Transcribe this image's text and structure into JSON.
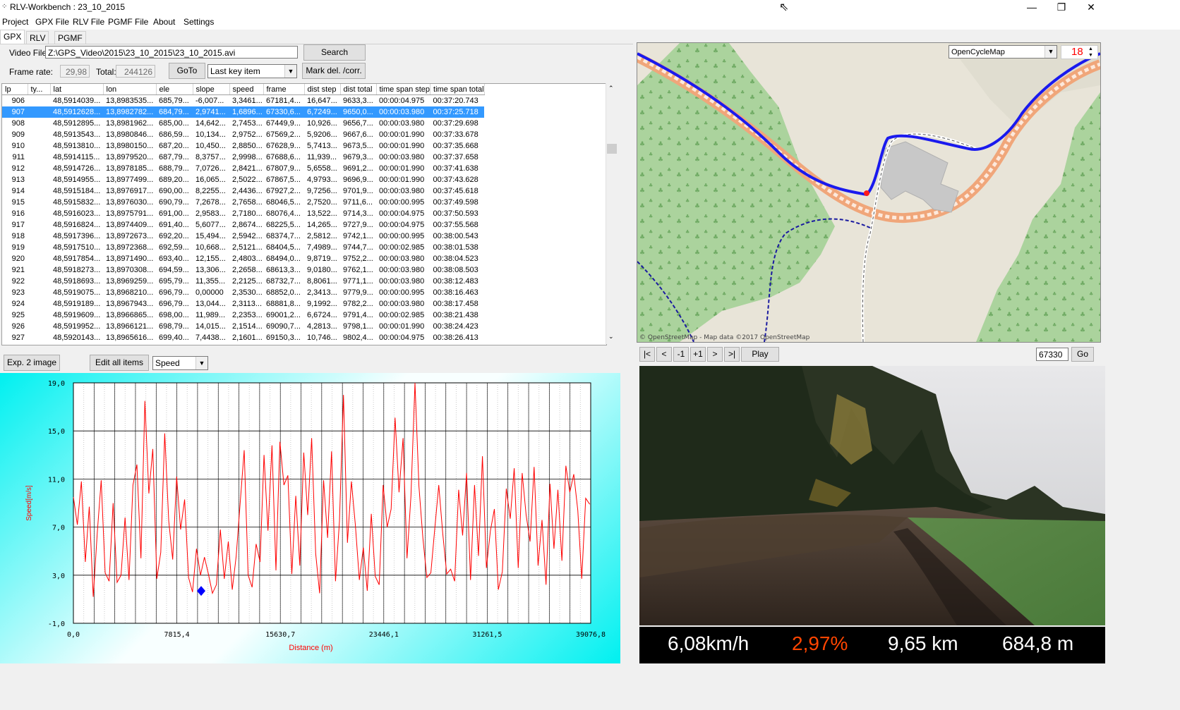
{
  "window": {
    "title": "RLV-Workbench : 23_10_2015",
    "app_icon_glyph": "⁘",
    "minimize": "—",
    "maximize": "❐",
    "close": "✕"
  },
  "menu": [
    "Project",
    "GPX File",
    "RLV File",
    "PGMF File",
    "About",
    "Settings"
  ],
  "tabs": [
    "GPX",
    "RLV",
    "PGMF"
  ],
  "form": {
    "video_file_label": "Video File:",
    "video_file_value": "Z:\\GPS_Video\\2015\\23_10_2015\\23_10_2015.avi",
    "search_label": "Search",
    "frame_rate_label": "Frame rate:",
    "frame_rate_value": "29,98",
    "total_label": "Total:",
    "total_value": "244126",
    "goto_label": "GoTo",
    "goto_mode": "Last key item",
    "mark_label": "Mark del. /corr."
  },
  "table": {
    "columns": [
      "lp",
      "ty...",
      "lat",
      "lon",
      "ele",
      "slope",
      "speed",
      "frame",
      "dist step",
      "dist total",
      "time span step",
      "time span total"
    ],
    "selected_lp": "907",
    "rows": [
      [
        "906",
        "",
        "48,5914039...",
        "13,8983535...",
        "685,79...",
        "-6,007...",
        "3,3461...",
        "67181,4...",
        "16,647...",
        "9633,3...",
        "00:00:04.975",
        "00:37:20.743"
      ],
      [
        "907",
        "",
        "48,5912628...",
        "13,8982782...",
        "684,79...",
        "2,9741...",
        "1,6896...",
        "67330,6...",
        "6,7249...",
        "9650,0...",
        "00:00:03.980",
        "00:37:25.718"
      ],
      [
        "908",
        "",
        "48,5912895...",
        "13,8981962...",
        "685,00...",
        "14,642...",
        "2,7453...",
        "67449,9...",
        "10,926...",
        "9656,7...",
        "00:00:03.980",
        "00:37:29.698"
      ],
      [
        "909",
        "",
        "48,5913543...",
        "13,8980846...",
        "686,59...",
        "10,134...",
        "2,9752...",
        "67569,2...",
        "5,9206...",
        "9667,6...",
        "00:00:01.990",
        "00:37:33.678"
      ],
      [
        "910",
        "",
        "48,5913810...",
        "13,8980150...",
        "687,20...",
        "10,450...",
        "2,8850...",
        "67628,9...",
        "5,7413...",
        "9673,5...",
        "00:00:01.990",
        "00:37:35.668"
      ],
      [
        "911",
        "",
        "48,5914115...",
        "13,8979520...",
        "687,79...",
        "8,3757...",
        "2,9998...",
        "67688,6...",
        "11,939...",
        "9679,3...",
        "00:00:03.980",
        "00:37:37.658"
      ],
      [
        "912",
        "",
        "48,5914726...",
        "13,8978185...",
        "688,79...",
        "7,0726...",
        "2,8421...",
        "67807,9...",
        "5,6558...",
        "9691,2...",
        "00:00:01.990",
        "00:37:41.638"
      ],
      [
        "913",
        "",
        "48,5914955...",
        "13,8977499...",
        "689,20...",
        "16,065...",
        "2,5022...",
        "67867,5...",
        "4,9793...",
        "9696,9...",
        "00:00:01.990",
        "00:37:43.628"
      ],
      [
        "914",
        "",
        "48,5915184...",
        "13,8976917...",
        "690,00...",
        "8,2255...",
        "2,4436...",
        "67927,2...",
        "9,7256...",
        "9701,9...",
        "00:00:03.980",
        "00:37:45.618"
      ],
      [
        "915",
        "",
        "48,5915832...",
        "13,8976030...",
        "690,79...",
        "7,2678...",
        "2,7658...",
        "68046,5...",
        "2,7520...",
        "9711,6...",
        "00:00:00.995",
        "00:37:49.598"
      ],
      [
        "916",
        "",
        "48,5916023...",
        "13,8975791...",
        "691,00...",
        "2,9583...",
        "2,7180...",
        "68076,4...",
        "13,522...",
        "9714,3...",
        "00:00:04.975",
        "00:37:50.593"
      ],
      [
        "917",
        "",
        "48,5916824...",
        "13,8974409...",
        "691,40...",
        "5,6077...",
        "2,8674...",
        "68225,5...",
        "14,265...",
        "9727,9...",
        "00:00:04.975",
        "00:37:55.568"
      ],
      [
        "918",
        "",
        "48,5917396...",
        "13,8972673...",
        "692,20...",
        "15,494...",
        "2,5942...",
        "68374,7...",
        "2,5812...",
        "9742,1...",
        "00:00:00.995",
        "00:38:00.543"
      ],
      [
        "919",
        "",
        "48,5917510...",
        "13,8972368...",
        "692,59...",
        "10,668...",
        "2,5121...",
        "68404,5...",
        "7,4989...",
        "9744,7...",
        "00:00:02.985",
        "00:38:01.538"
      ],
      [
        "920",
        "",
        "48,5917854...",
        "13,8971490...",
        "693,40...",
        "12,155...",
        "2,4803...",
        "68494,0...",
        "9,8719...",
        "9752,2...",
        "00:00:03.980",
        "00:38:04.523"
      ],
      [
        "921",
        "",
        "48,5918273...",
        "13,8970308...",
        "694,59...",
        "13,306...",
        "2,2658...",
        "68613,3...",
        "9,0180...",
        "9762,1...",
        "00:00:03.980",
        "00:38:08.503"
      ],
      [
        "922",
        "",
        "48,5918693...",
        "13,8969259...",
        "695,79...",
        "11,355...",
        "2,2125...",
        "68732,7...",
        "8,8061...",
        "9771,1...",
        "00:00:03.980",
        "00:38:12.483"
      ],
      [
        "923",
        "",
        "48,5919075...",
        "13,8968210...",
        "696,79...",
        "0,00000",
        "2,3530...",
        "68852,0...",
        "2,3413...",
        "9779,9...",
        "00:00:00.995",
        "00:38:16.463"
      ],
      [
        "924",
        "",
        "48,5919189...",
        "13,8967943...",
        "696,79...",
        "13,044...",
        "2,3113...",
        "68881,8...",
        "9,1992...",
        "9782,2...",
        "00:00:03.980",
        "00:38:17.458"
      ],
      [
        "925",
        "",
        "48,5919609...",
        "13,8966865...",
        "698,00...",
        "11,989...",
        "2,2353...",
        "69001,2...",
        "6,6724...",
        "9791,4...",
        "00:00:02.985",
        "00:38:21.438"
      ],
      [
        "926",
        "",
        "48,5919952...",
        "13,8966121...",
        "698,79...",
        "14,015...",
        "2,1514...",
        "69090,7...",
        "4,2813...",
        "9798,1...",
        "00:00:01.990",
        "00:38:24.423"
      ],
      [
        "927",
        "",
        "48,5920143...",
        "13,8965616...",
        "699,40...",
        "7,4438...",
        "2,1601...",
        "69150,3...",
        "10,746...",
        "9802,4...",
        "00:00:04.975",
        "00:38:26.413"
      ]
    ]
  },
  "chart_toolbar": {
    "export_label": "Exp. 2 image",
    "edit_label": "Edit all items",
    "series_select": "Speed"
  },
  "chart_data": {
    "type": "line",
    "xlabel": "Distance (m)",
    "ylabel": "Speed[m/s]",
    "xlim": [
      0,
      39076.8
    ],
    "ylim": [
      -1,
      19
    ],
    "x_ticks": [
      "0,0",
      "7815,4",
      "15630,7",
      "23446,1",
      "31261,5",
      "39076,8"
    ],
    "y_ticks": [
      "-1,0",
      "3,0",
      "7,0",
      "11,0",
      "15,0",
      "19,0"
    ],
    "grid": true,
    "series": [
      {
        "color": "#ff0000",
        "x": [
          0,
          300,
          600,
          900,
          1200,
          1500,
          1800,
          2100,
          2400,
          2700,
          3000,
          3300,
          3600,
          3900,
          4200,
          4500,
          4800,
          5100,
          5400,
          5700,
          6000,
          6300,
          6600,
          6900,
          7200,
          7500,
          7800,
          8100,
          8400,
          8700,
          9000,
          9300,
          9600,
          9900,
          10200,
          10500,
          10800,
          11100,
          11400,
          11700,
          12000,
          12300,
          12600,
          12900,
          13200,
          13500,
          13800,
          14100,
          14400,
          14700,
          15000,
          15300,
          15600,
          15900,
          16200,
          16500,
          16800,
          17100,
          17400,
          17700,
          18000,
          18300,
          18600,
          18900,
          19200,
          19500,
          19800,
          20100,
          20400,
          20700,
          21000,
          21300,
          21600,
          21900,
          22200,
          22500,
          22800,
          23100,
          23400,
          23700,
          24000,
          24300,
          24600,
          24900,
          25200,
          25500,
          25800,
          26100,
          26400,
          26700,
          27000,
          27300,
          27600,
          27900,
          28200,
          28500,
          28800,
          29100,
          29400,
          29700,
          30000,
          30300,
          30600,
          30900,
          31200,
          31500,
          31800,
          32100,
          32400,
          32700,
          33000,
          33300,
          33600,
          33900,
          34200,
          34500,
          34800,
          35100,
          35400,
          35700,
          36000,
          36300,
          36600,
          36900,
          37200,
          37500,
          37800,
          38100,
          38400,
          38700,
          39000
        ],
        "values": [
          9.5,
          7.2,
          10.8,
          4.1,
          8.7,
          1.2,
          6.5,
          10.9,
          3.2,
          2.5,
          9.0,
          2.4,
          3.0,
          7.8,
          2.6,
          10.5,
          12.2,
          4.4,
          17.5,
          9.8,
          13.5,
          2.7,
          4.9,
          14.8,
          7.5,
          4.3,
          11.2,
          6.8,
          9.3,
          2.8,
          1.6,
          5.2,
          3.0,
          4.5,
          3.1,
          1.5,
          2.2,
          6.8,
          2.7,
          5.8,
          1.8,
          4.6,
          9.0,
          13.4,
          3.0,
          2.0,
          5.6,
          4.1,
          13.0,
          6.7,
          13.8,
          3.4,
          14.1,
          10.5,
          11.3,
          3.1,
          9.6,
          3.8,
          13.2,
          8.0,
          14.4,
          4.8,
          1.5,
          10.9,
          6.1,
          13.3,
          2.5,
          7.5,
          18.0,
          5.7,
          10.8,
          7.2,
          2.6,
          5.3,
          1.7,
          8.1,
          2.9,
          2.2,
          10.5,
          7.0,
          8.5,
          16.1,
          9.9,
          14.4,
          4.4,
          9.6,
          19.0,
          10.4,
          6.1,
          2.8,
          3.2,
          6.9,
          10.5,
          6.5,
          3.1,
          3.5,
          2.5,
          10.1,
          6.3,
          11.5,
          2.6,
          10.5,
          4.6,
          12.9,
          3.6,
          6.7,
          8.5,
          1.8,
          3.3,
          10.2,
          7.7,
          11.9,
          3.6,
          11.5,
          8.0,
          5.8,
          12.0,
          3.8,
          7.6,
          2.2,
          10.6,
          5.2,
          10.1,
          4.2,
          12.1,
          9.9,
          11.4,
          8.4,
          2.7,
          9.4,
          8.9
        ]
      }
    ],
    "marker": {
      "x": 9650,
      "y": 1.69,
      "color": "#0000ff"
    }
  },
  "map": {
    "layer": "OpenCycleMap",
    "zoom": "18",
    "attribution": "© OpenStreetMap - Map data ©2017 OpenStreetMap"
  },
  "player": {
    "first": "|<",
    "prev": "<",
    "minus1": "-1",
    "plus1": "+1",
    "next": ">",
    "last": ">|",
    "play": "Play",
    "frame_value": "67330",
    "go_label": "Go"
  },
  "stats": {
    "speed": "6,08km/h",
    "slope": "2,97%",
    "distance": "9,65 km",
    "elevation": "684,8 m"
  },
  "colors": {
    "selection": "#3399ff",
    "chart_line": "#ff0000",
    "slope_text": "#ff4500",
    "zoom_text": "#ff0000",
    "track": "#1a1aee"
  }
}
